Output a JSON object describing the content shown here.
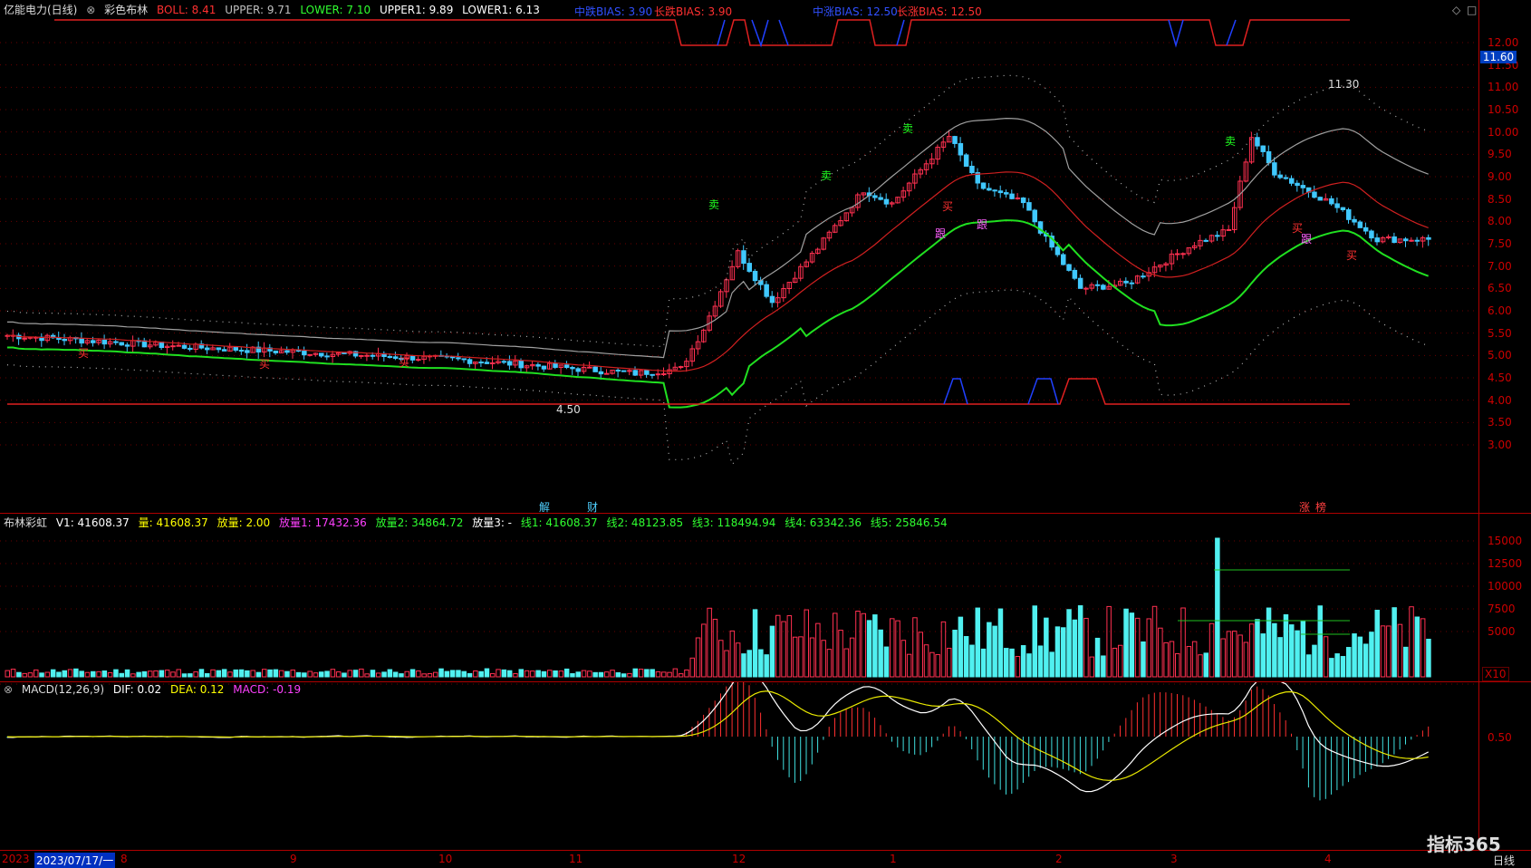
{
  "main": {
    "stock": "亿能电力(日线)",
    "indicator": "彩色布林",
    "items": [
      {
        "label": "BOLL: 8.41",
        "color": "#ff3030"
      },
      {
        "label": "UPPER: 9.71",
        "color": "#c0c0c0"
      },
      {
        "label": "LOWER: 7.10",
        "color": "#30ff30"
      },
      {
        "label": "UPPER1: 9.89",
        "color": "#ffffff"
      },
      {
        "label": "LOWER1: 6.13",
        "color": "#ffffff"
      }
    ],
    "bias_labels": [
      "中跌BIAS: 3.90",
      "长跌BIAS: 3.90",
      "中涨BIAS: 12.50",
      "长涨BIAS: 12.50"
    ],
    "price_ticks": [
      "12.00",
      "11.50",
      "11.00",
      "10.50",
      "10.00",
      "9.50",
      "9.00",
      "8.50",
      "8.00",
      "7.50",
      "7.00",
      "6.50",
      "6.00",
      "5.50",
      "5.00",
      "4.50",
      "4.00",
      "3.50",
      "3.00"
    ],
    "current_price": "11.60",
    "high_label": "11.30",
    "low_label": "4.50",
    "signals": {
      "sell": "卖",
      "buy": "买",
      "follow": "跟"
    },
    "events": [
      "解",
      "财",
      "涨",
      "榜"
    ]
  },
  "volume": {
    "indicator": "布林彩虹",
    "items": [
      {
        "label": "V1: 41608.37",
        "color": "#ffffff"
      },
      {
        "label": "量: 41608.37",
        "color": "#ffff00"
      },
      {
        "label": "放量: 2.00",
        "color": "#ffff00"
      },
      {
        "label": "放量1: 17432.36",
        "color": "#ff40ff"
      },
      {
        "label": "放量2: 34864.72",
        "color": "#30ff30"
      },
      {
        "label": "放量3: -",
        "color": "#ffffff"
      },
      {
        "label": "线1: 41608.37",
        "color": "#30ff30"
      },
      {
        "label": "线2: 48123.85",
        "color": "#30ff30"
      },
      {
        "label": "线3: 118494.94",
        "color": "#30ff30"
      },
      {
        "label": "线4: 63342.36",
        "color": "#30ff30"
      },
      {
        "label": "线5: 25846.54",
        "color": "#30ff30"
      }
    ],
    "ticks": [
      "15000",
      "12500",
      "10000",
      "7500",
      "5000"
    ],
    "multiplier": "X10"
  },
  "macd": {
    "indicator": "MACD(12,26,9)",
    "items": [
      {
        "label": "DIF: 0.02",
        "color": "#ffffff"
      },
      {
        "label": "DEA: 0.12",
        "color": "#ffff00"
      },
      {
        "label": "MACD: -0.19",
        "color": "#ff40ff"
      }
    ],
    "ticks": [
      "0.50"
    ]
  },
  "time_axis": {
    "year_label": "2023",
    "selected_date": "2023/07/17/一",
    "months": [
      "8",
      "9",
      "10",
      "11",
      "12",
      "1",
      "2",
      "3",
      "4"
    ],
    "period": "日线"
  },
  "logo": "指标365"
}
